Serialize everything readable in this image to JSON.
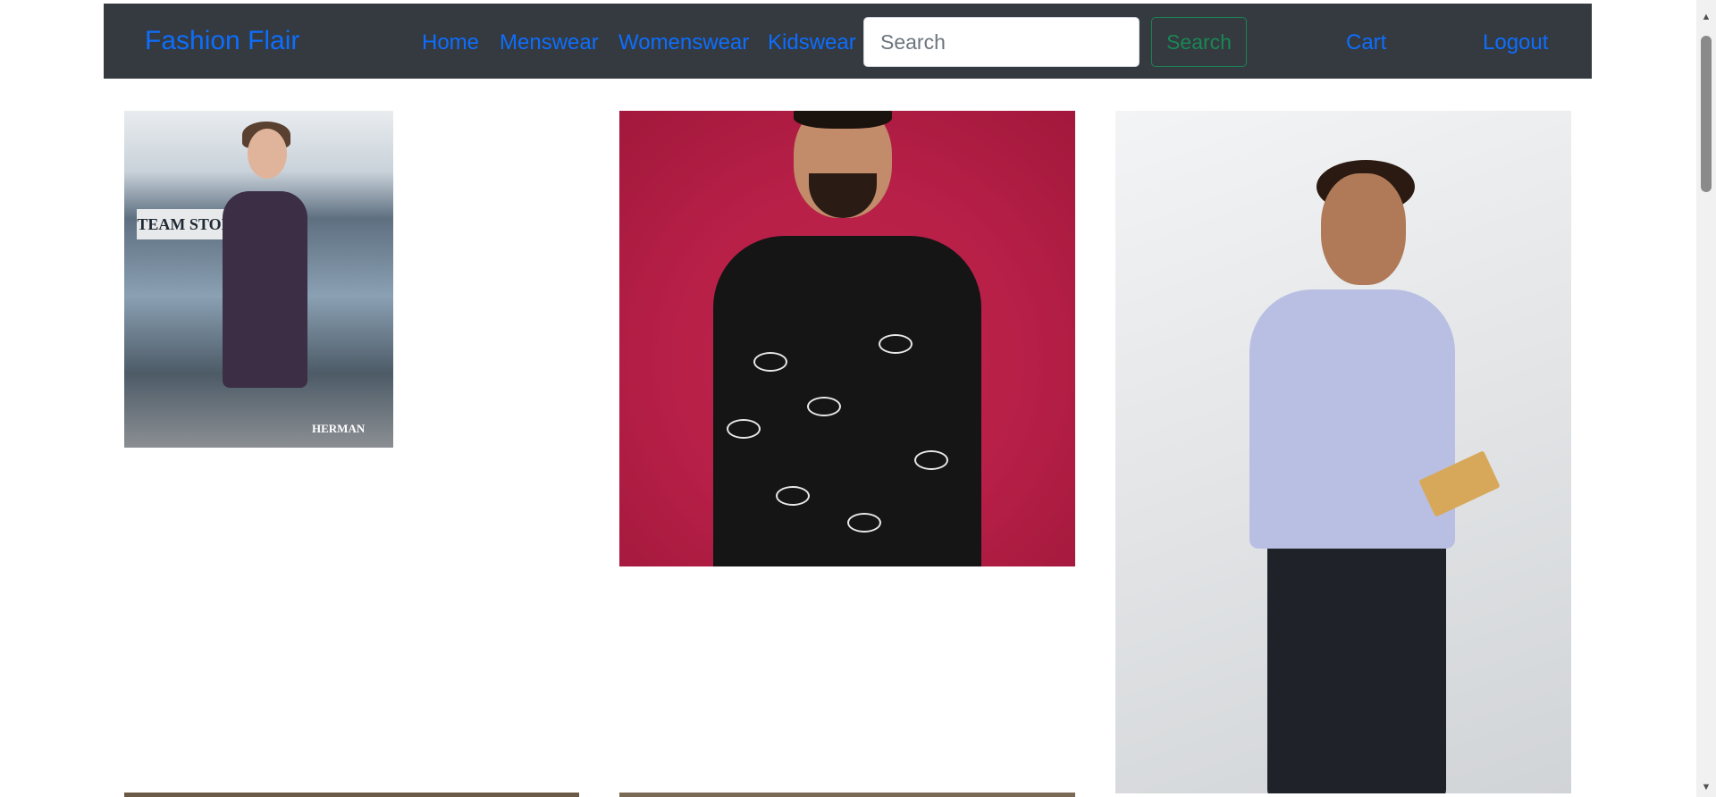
{
  "navbar": {
    "brand": "Fashion Flair",
    "links": {
      "home": "Home",
      "menswear": "Menswear",
      "womenswear": "Womenswear",
      "kidswear": "Kidswear",
      "cart": "Cart",
      "logout": "Logout"
    },
    "search": {
      "placeholder": "Search",
      "value": "",
      "button_label": "Search"
    }
  },
  "products": [
    {
      "image_label": "TEAM STORE",
      "watermark": "HERMAN"
    },
    {
      "image_label": ""
    },
    {
      "image_label": ""
    }
  ],
  "colors": {
    "navbar_bg": "#343a40",
    "link": "#0d6efd",
    "search_button": "#198754"
  },
  "icons": {
    "scroll_up": "triangle-up-icon",
    "scroll_down": "triangle-down-icon"
  }
}
